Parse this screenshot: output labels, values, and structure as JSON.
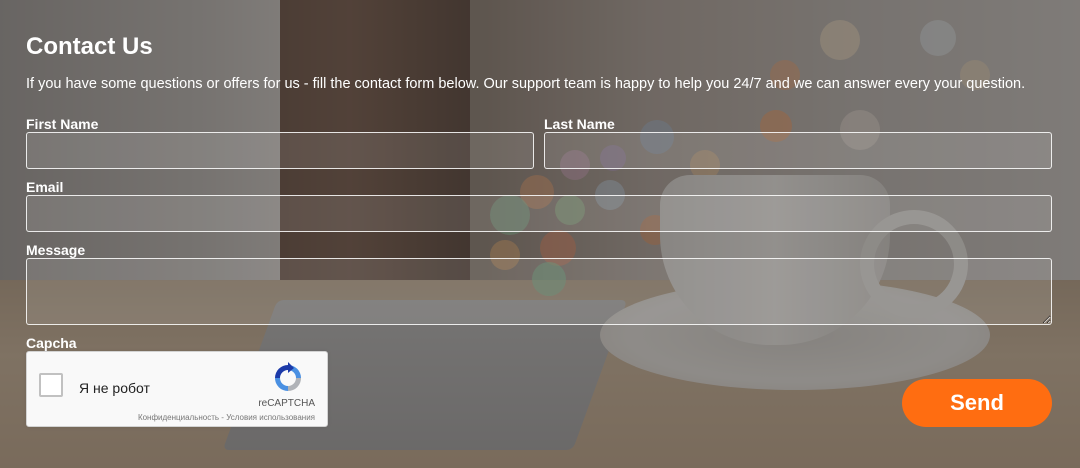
{
  "form": {
    "title": "Contact Us",
    "intro": "If you have some questions or offers for us - fill the contact form below. Our support team is happy to help you 24/7 and we can answer every your question.",
    "first_name_label": "First Name",
    "first_name_value": "",
    "last_name_label": "Last Name",
    "last_name_value": "",
    "email_label": "Email",
    "email_value": "",
    "message_label": "Message",
    "message_value": "",
    "captcha_label": "Capcha",
    "send_label": "Send"
  },
  "recaptcha": {
    "checkbox_label": "Я не робот",
    "checked": false,
    "brand": "reCAPTCHA",
    "links": "Конфиденциальность - Условия использования",
    "logo_icon": "recaptcha-logo-icon"
  },
  "colors": {
    "accent": "#ff6d11",
    "text": "#ffffff",
    "field_border": "#ffffff"
  }
}
